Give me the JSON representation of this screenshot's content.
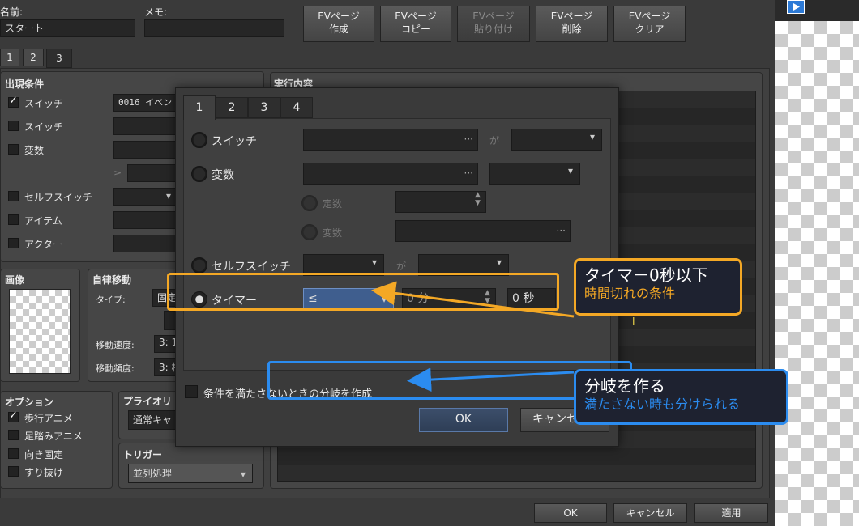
{
  "top": {
    "name_label": "名前:",
    "name_value": "スタート",
    "memo_label": "メモ:",
    "memo_value": "",
    "page_buttons": [
      {
        "label": "EVページ\n作成",
        "enabled": true
      },
      {
        "label": "EVページ\nコピー",
        "enabled": true
      },
      {
        "label": "EVページ\n貼り付け",
        "enabled": false
      },
      {
        "label": "EVページ\n削除",
        "enabled": true
      },
      {
        "label": "EVページ\nクリア",
        "enabled": true
      }
    ],
    "page_tabs": [
      "1",
      "2",
      "3"
    ]
  },
  "conditions": {
    "title": "出現条件",
    "rows": [
      {
        "label": "スイッチ",
        "checked": true,
        "value": "0016 イベン"
      },
      {
        "label": "スイッチ",
        "checked": false,
        "value": ""
      },
      {
        "label": "変数",
        "checked": false,
        "value": ""
      },
      {
        "label": "セルフスイッチ",
        "checked": false,
        "value": ""
      },
      {
        "label": "アイテム",
        "checked": false,
        "value": ""
      },
      {
        "label": "アクター",
        "checked": false,
        "value": ""
      }
    ],
    "gte_symbol": "≥"
  },
  "image": {
    "title": "画像"
  },
  "autonomous": {
    "title": "自律移動",
    "type_label": "タイプ:",
    "type_value": "固定",
    "speed_label": "移動速度:",
    "speed_value": "3: 1",
    "freq_label": "移動頻度:",
    "freq_value": "3: 標"
  },
  "options": {
    "title": "オプション",
    "items": [
      {
        "label": "歩行アニメ",
        "checked": true
      },
      {
        "label": "足踏みアニメ",
        "checked": false
      },
      {
        "label": "向き固定",
        "checked": false
      },
      {
        "label": "すり抜け",
        "checked": false
      }
    ]
  },
  "priority": {
    "title": "プライオリ",
    "value": "通常キャ"
  },
  "trigger": {
    "title": "トリガー",
    "value": "並列処理"
  },
  "contents": {
    "title": "実行内容"
  },
  "bottom_buttons": {
    "ok": "OK",
    "cancel": "キャンセル",
    "apply": "適用"
  },
  "dialog": {
    "tabs": [
      "1",
      "2",
      "3",
      "4"
    ],
    "switch_label": "スイッチ",
    "switch_ga": "が",
    "variable_label": "変数",
    "constant_label": "定数",
    "var_label": "変数",
    "selfswitch_label": "セルフスイッチ",
    "selfswitch_ga": "が",
    "timer_label": "タイマー",
    "timer_op": "≤",
    "timer_min": "0 分",
    "timer_sec": "0 秒",
    "else_label": "条件を満たさないときの分岐を作成",
    "ok": "OK",
    "cancel": "キャンセル",
    "dots": "···"
  },
  "callouts": {
    "timer": {
      "title": "タイマー0秒以下",
      "sub": "時間切れの条件",
      "color": "#f4a825"
    },
    "branch": {
      "title": "分岐を作る",
      "sub": "満たさない時も分けられる",
      "color": "#2b8cf0"
    }
  },
  "colors": {
    "bg": "#3a3a3a",
    "panel": "#464646",
    "field": "#262626",
    "orange": "#f4a825",
    "blue": "#2b8cf0"
  }
}
